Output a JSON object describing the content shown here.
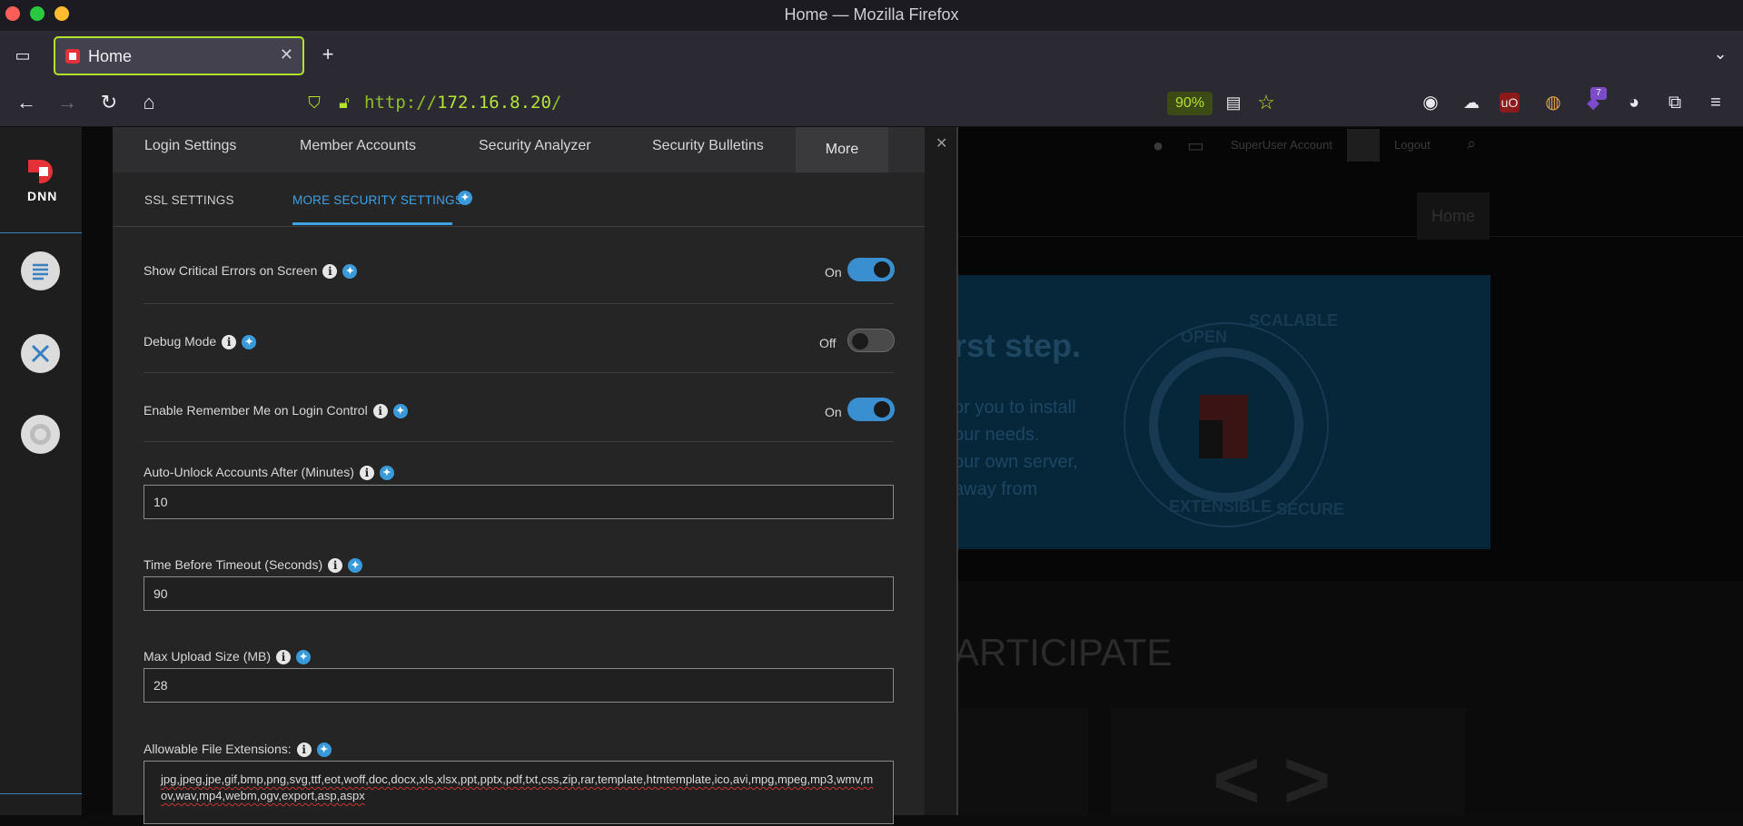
{
  "window": {
    "title": "Home — Mozilla Firefox"
  },
  "browser": {
    "tab_label": "Home",
    "url_scheme": "http://",
    "url_host": "172.16.8.20",
    "url_path": "/",
    "zoom": "90%",
    "extension_badge": "7"
  },
  "background_page": {
    "topbar_user": "SuperUser Account",
    "topbar_logout": "Logout",
    "menu_home": "Home",
    "hero_title": "rst step.",
    "hero_lines": [
      "or you to install",
      "our needs.",
      "our own server,",
      "away from"
    ],
    "seal_words": [
      "OPEN",
      "SCALABLE",
      "EXTENSIBLE",
      "SECURE"
    ],
    "section_title": "ARTICIPATE"
  },
  "dnn": {
    "logo_text": "DNN"
  },
  "panel": {
    "tabs": [
      "Login Settings",
      "Member Accounts",
      "Security Analyzer",
      "Security Bulletins",
      "More"
    ],
    "subtabs": [
      "SSL SETTINGS",
      "MORE SECURITY SETTINGS"
    ],
    "settings": {
      "critical_errors": {
        "label": "Show Critical Errors on Screen",
        "state": "On"
      },
      "debug_mode": {
        "label": "Debug Mode",
        "state": "Off"
      },
      "remember_me": {
        "label": "Enable Remember Me on Login Control",
        "state": "On"
      },
      "auto_unlock": {
        "label": "Auto-Unlock Accounts After (Minutes)",
        "value": "10"
      },
      "timeout": {
        "label": "Time Before Timeout (Seconds)",
        "value": "90"
      },
      "max_upload": {
        "label": "Max Upload Size (MB)",
        "value": "28"
      },
      "file_extensions": {
        "label": "Allowable File Extensions:",
        "value": "jpg,jpeg,jpe,gif,bmp,png,svg,ttf,eot,woff,doc,docx,xls,xlsx,ppt,pptx,pdf,txt,css,zip,rar,template,htmtemplate,ico,avi,mpg,mpeg,mp3,wmv,mov,wav,mp4,webm,ogv,export,asp,aspx"
      }
    }
  },
  "colors": {
    "accent": "#3ea3e6",
    "url_green": "#b5e43a",
    "toggle_on": "#3a8fd0"
  }
}
